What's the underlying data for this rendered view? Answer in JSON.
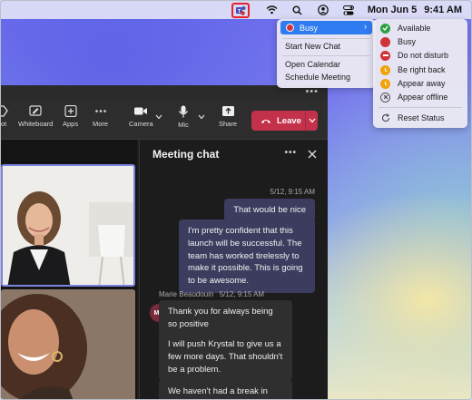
{
  "menubar": {
    "date": "Mon Jun 5",
    "time": "9:41 AM"
  },
  "status_menu": {
    "current_status": "Busy",
    "items": [
      "Start New Chat",
      "Open Calendar",
      "Schedule Meeting"
    ]
  },
  "presence_menu": {
    "items": [
      {
        "label": "Available",
        "color": "#2ea043"
      },
      {
        "label": "Busy",
        "color": "#d13438"
      },
      {
        "label": "Do not disturb",
        "color": "#d13438"
      },
      {
        "label": "Be right back",
        "color": "#f0a30a"
      },
      {
        "label": "Appear away",
        "color": "#f0a30a"
      },
      {
        "label": "Appear offline",
        "color": "#8a8886"
      }
    ],
    "reset_label": "Reset Status"
  },
  "toolbar": {
    "partial_label": "hot",
    "whiteboard": "Whiteboard",
    "apps": "Apps",
    "more": "More",
    "camera": "Camera",
    "mic": "Mic",
    "share": "Share",
    "leave": "Leave"
  },
  "chat": {
    "title": "Meeting chat",
    "my_timestamp": "5/12, 9:15 AM",
    "my_messages": [
      "That would be nice",
      "I'm pretty confident that this launch will be successful. The team has worked tirelessly to make it possible. This is going to be awesome."
    ],
    "other_sender": "Marie Beaudouin",
    "other_timestamp": "5/12, 9:15 AM",
    "other_initials": "MB",
    "other_messages": [
      "Thank you for always being so positive",
      "I will push Krystal to give us a few more days. That shouldn't be a problem.",
      "We haven't had a break in"
    ]
  },
  "colors": {
    "accent": "#2f7bf0",
    "leave": "#c4314b",
    "my_bubble": "#3b3c5e"
  }
}
